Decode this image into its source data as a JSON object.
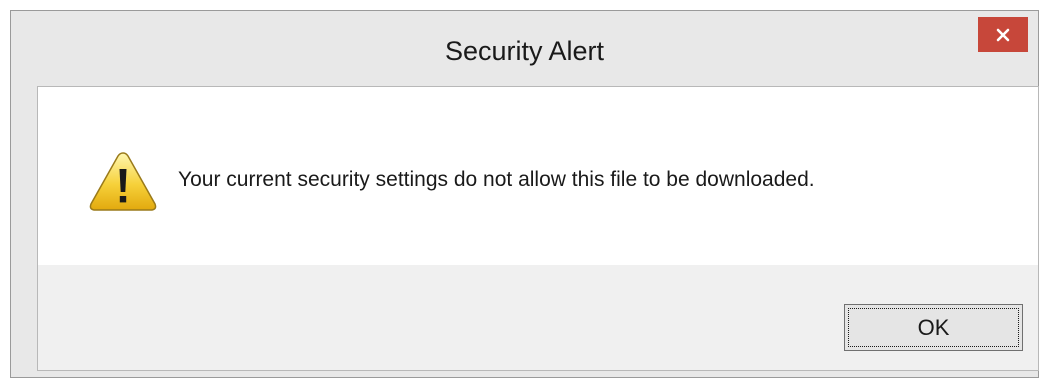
{
  "dialog": {
    "title": "Security Alert",
    "message": "Your current security settings do not allow this file to be downloaded.",
    "icon": "warning-icon",
    "ok_label": "OK",
    "close_icon": "close-icon"
  },
  "colors": {
    "close_button": "#c7473a",
    "frame": "#e8e8e8",
    "message_background": "#ffffff",
    "button_area": "#f0f0f0"
  }
}
